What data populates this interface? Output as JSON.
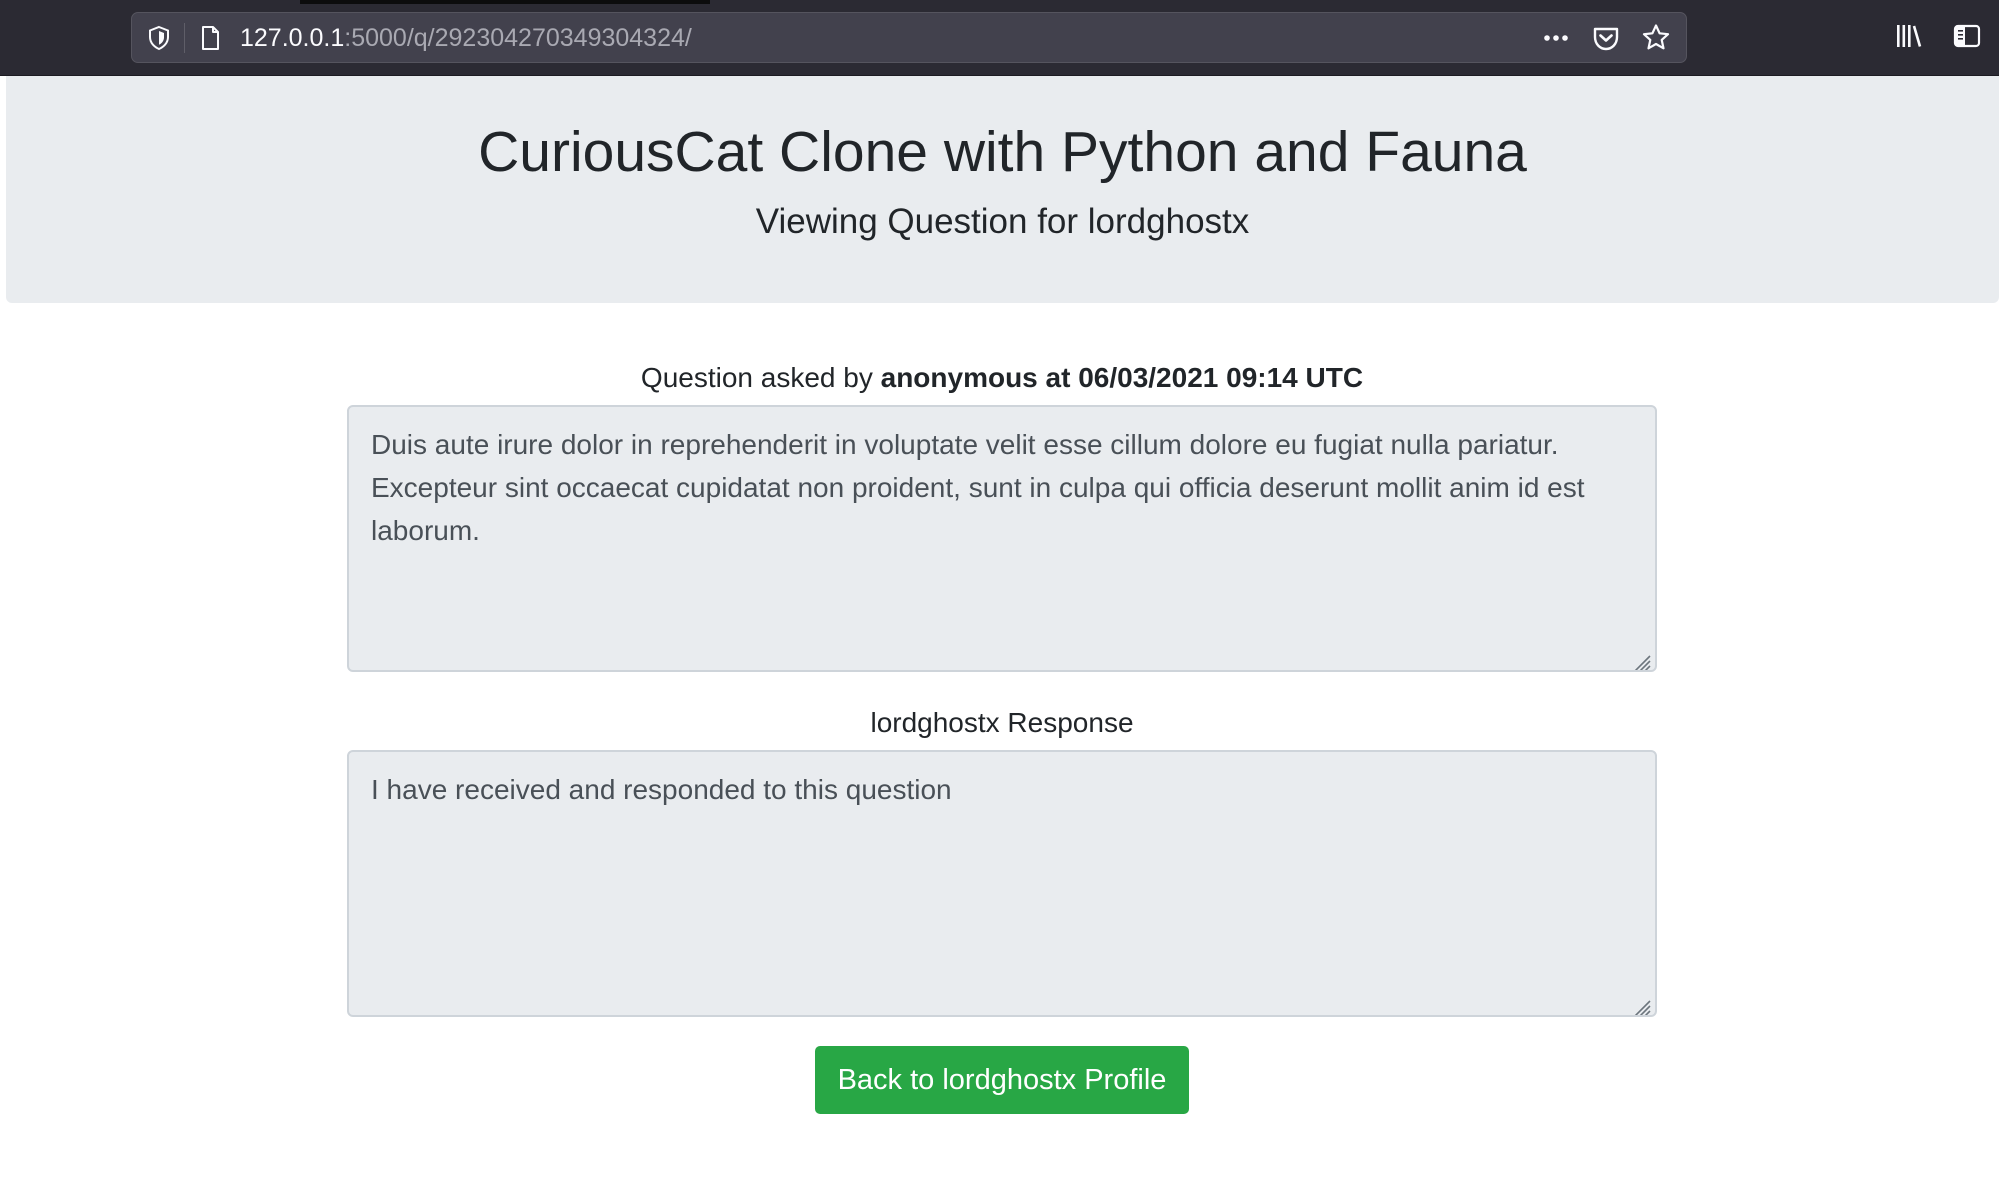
{
  "browser": {
    "url_host": "127.0.0.1",
    "url_path": ":5000/q/292304270349304324/",
    "icons": [
      "shield-icon",
      "page-icon",
      "more-icon",
      "pocket-icon",
      "bookmark-star-icon",
      "library-icon",
      "sidebar-icon"
    ]
  },
  "header": {
    "title": "CuriousCat Clone with Python and Fauna",
    "subtitle": "Viewing Question for lordghostx"
  },
  "question": {
    "asked_prefix": "Question asked by ",
    "asked_by": "anonymous at 06/03/2021 09:14 UTC",
    "text": "Duis aute irure dolor in reprehenderit in voluptate velit esse cillum dolore eu fugiat nulla pariatur. Excepteur sint occaecat cupidatat non proident, sunt in culpa qui officia deserunt mollit anim id est laborum."
  },
  "response": {
    "label": "lordghostx Response",
    "text": "I have received and responded to this question"
  },
  "actions": {
    "back_label": "Back to lordghostx Profile"
  },
  "colors": {
    "jumbotron_bg": "#e9ecef",
    "button_success": "#28a745",
    "browser_chrome": "#2b2a33"
  }
}
